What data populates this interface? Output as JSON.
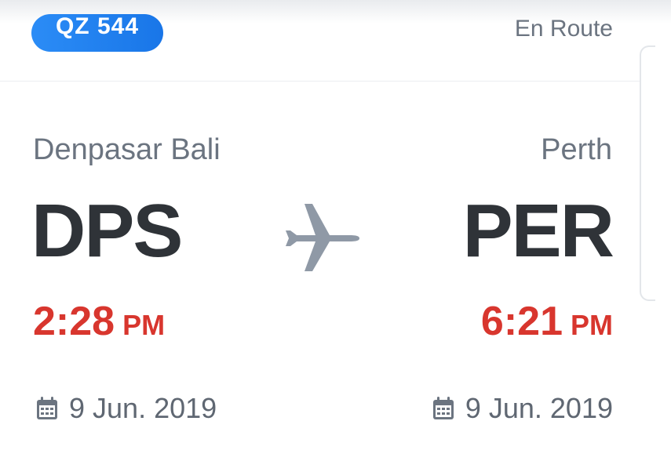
{
  "flight": {
    "number": "QZ 544",
    "status": "En Route"
  },
  "origin": {
    "city": "Denpasar Bali",
    "code": "DPS",
    "time": "2:28",
    "ampm": "PM",
    "date": "9 Jun. 2019"
  },
  "destination": {
    "city": "Perth",
    "code": "PER",
    "time": "6:21",
    "ampm": "PM",
    "date": "9 Jun. 2019"
  },
  "icons": {
    "plane": "airplane-icon",
    "calendar": "calendar-icon"
  },
  "colors": {
    "badge": "#1976e8",
    "time": "#d8362e",
    "code": "#2f3338",
    "muted": "#6b7480"
  }
}
